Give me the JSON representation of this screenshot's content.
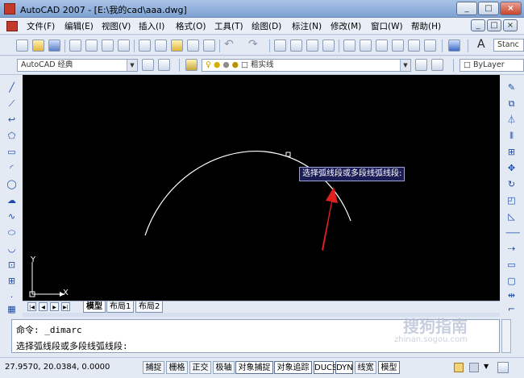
{
  "window": {
    "title": "AutoCAD 2007 - [E:\\我的cad\\aaa.dwg]",
    "controls": [
      "_",
      "□",
      "×"
    ],
    "doc_controls": [
      "_",
      "□",
      "×"
    ]
  },
  "menu": [
    "文件(F)",
    "编辑(E)",
    "视图(V)",
    "插入(I)",
    "格式(O)",
    "工具(T)",
    "绘图(D)",
    "标注(N)",
    "修改(M)",
    "窗口(W)",
    "帮助(H)"
  ],
  "toolbar": {
    "workspace": "AutoCAD 经典",
    "linetype": "粗实线",
    "layer_color": "ByLayer",
    "style_partial": "Stanc"
  },
  "drawing": {
    "ucs_x": "X",
    "ucs_y": "Y",
    "tooltip": "选择弧线段或多段线弧线段:"
  },
  "tabs": [
    "模型",
    "布局1",
    "布局2"
  ],
  "command": {
    "line1": "命令: _dimarc",
    "line2": "选择弧线段或多段线弧线段:"
  },
  "status": {
    "coords": "27.9570, 20.0384, 0.0000",
    "buttons": [
      "捕捉",
      "栅格",
      "正交",
      "极轴",
      "对象捕捉",
      "对象追踪",
      "DUCS",
      "DYN",
      "线宽",
      "模型"
    ]
  },
  "watermark": {
    "main": "搜狗指南",
    "sub": "zhinan.sogou.com"
  }
}
